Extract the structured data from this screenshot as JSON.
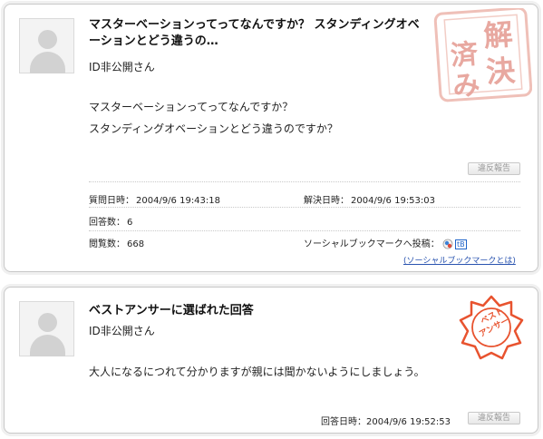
{
  "question": {
    "title": "マスターベーションってってなんですか？ スタンディングオベーションとどう違うの…",
    "user": "ID非公開さん",
    "body_line1": "マスターベーションってってなんですか？",
    "body_line2": "スタンディングオベーションとどう違うのですか？",
    "report_label": "違反報告",
    "posted_label": "質問日時：",
    "posted_value": "2004/9/6 19:43:18",
    "resolved_label": "解決日時：",
    "resolved_value": "2004/9/6 19:53:03",
    "answers_label": "回答数：",
    "answers_value": "6",
    "views_label": "閲覧数：",
    "views_value": "668",
    "social_label": "ソーシャルブックマークへ投稿：",
    "social_badge": "tB",
    "social_link": "(ソーシャルブックマークとは)",
    "stamp_text": "解決済み"
  },
  "answer": {
    "title": "ベストアンサーに選ばれた回答",
    "user": "ID非公開さん",
    "body": "大人になるにつれて分かりますが親には聞かないようにしましょう。",
    "date_label": "回答日時：",
    "date_value": "2004/9/6 19:52:53",
    "report_label": "違反報告",
    "stamp_text": "ベストアンサー"
  },
  "colors": {
    "stamp_resolved": "#e8a8a0",
    "stamp_best": "#e8532f",
    "link": "#2a54b0"
  }
}
